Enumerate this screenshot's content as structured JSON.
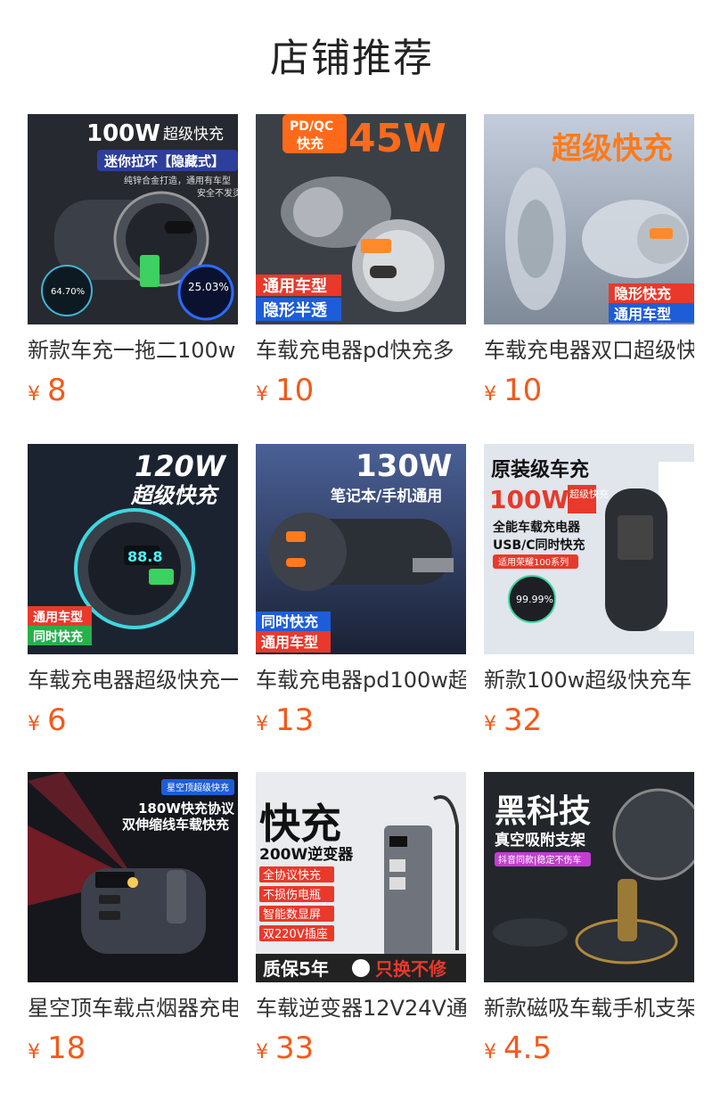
{
  "page": {
    "title": "店铺推荐"
  },
  "products": [
    {
      "name": "新款车充一拖二100w",
      "currency": "¥",
      "price": "8",
      "image": {
        "headline": "100W",
        "headline_sub": "超级快充",
        "tag": "迷你拉环【隐藏式】",
        "line1": "纯锌合金打造，通用有车型",
        "line2": "安全不发烫",
        "stat_left": "64.70%",
        "stat_right": "25.03%",
        "bg": "#2a2d33",
        "accent": "#ffffff"
      }
    },
    {
      "name": "车载充电器pd快充多",
      "currency": "¥",
      "price": "10",
      "image": {
        "badge_top": "PD/QC",
        "badge_bottom": "快充",
        "headline": "45W",
        "tag1": "通用车型",
        "tag2": "隐形半透",
        "bg": "#3a3f47",
        "accent": "#ff6a1a"
      }
    },
    {
      "name": "车载充电器双口超级快",
      "currency": "¥",
      "price": "10",
      "image": {
        "headline": "超级快充",
        "tag1": "隐形快充",
        "tag2": "通用车型",
        "bg": "#aeb9c8",
        "accent": "#ff7a1a"
      }
    },
    {
      "name": "车载充电器超级快充一",
      "currency": "¥",
      "price": "6",
      "image": {
        "headline": "120W",
        "headline_sub": "超级快充",
        "tag1": "通用车型",
        "tag2": "同时快充",
        "bg": "#1c2330",
        "accent": "#ffffff"
      }
    },
    {
      "name": "车载充电器pd100w超",
      "currency": "¥",
      "price": "13",
      "image": {
        "headline": "130W",
        "headline_sub": "笔记本/手机通用",
        "tag1": "同时快充",
        "tag2": "通用车型",
        "bg": "#3b4f7c",
        "accent": "#ffffff"
      }
    },
    {
      "name": "新款100w超级快充车",
      "currency": "¥",
      "price": "32",
      "image": {
        "headline": "原装级车充",
        "big": "100W",
        "big_sub": "超级快充",
        "line1": "全能车载充电器",
        "line2": "USB/C同时快充",
        "tag": "适用荣耀100系列",
        "stat": "99.99%",
        "bg": "#dfe3ea",
        "accent": "#e8392b"
      }
    },
    {
      "name": "星空顶车载点烟器充电",
      "currency": "¥",
      "price": "18",
      "image": {
        "tag": "星空顶超级快充",
        "line1": "180W快充协议",
        "line2": "双伸缩线车载快充",
        "bg": "#14161c",
        "accent": "#ffffff"
      }
    },
    {
      "name": "车载逆变器12V24V通",
      "currency": "¥",
      "price": "33",
      "image": {
        "headline": "快充",
        "sub": "200W逆变器",
        "tags": [
          "全协议快充",
          "不损伤电瓶",
          "智能数显屏",
          "双220V插座"
        ],
        "footer_left": "质保5年",
        "footer_right": "只换不修",
        "bg": "#e9ebee",
        "accent": "#e8392b"
      }
    },
    {
      "name": "新款磁吸车载手机支架",
      "currency": "¥",
      "price": "4.5",
      "image": {
        "headline": "黑科技",
        "sub": "真空吸附支架",
        "tag": "抖音同款|稳定不伤车",
        "bg": "#23262b",
        "accent": "#ffffff"
      }
    }
  ]
}
